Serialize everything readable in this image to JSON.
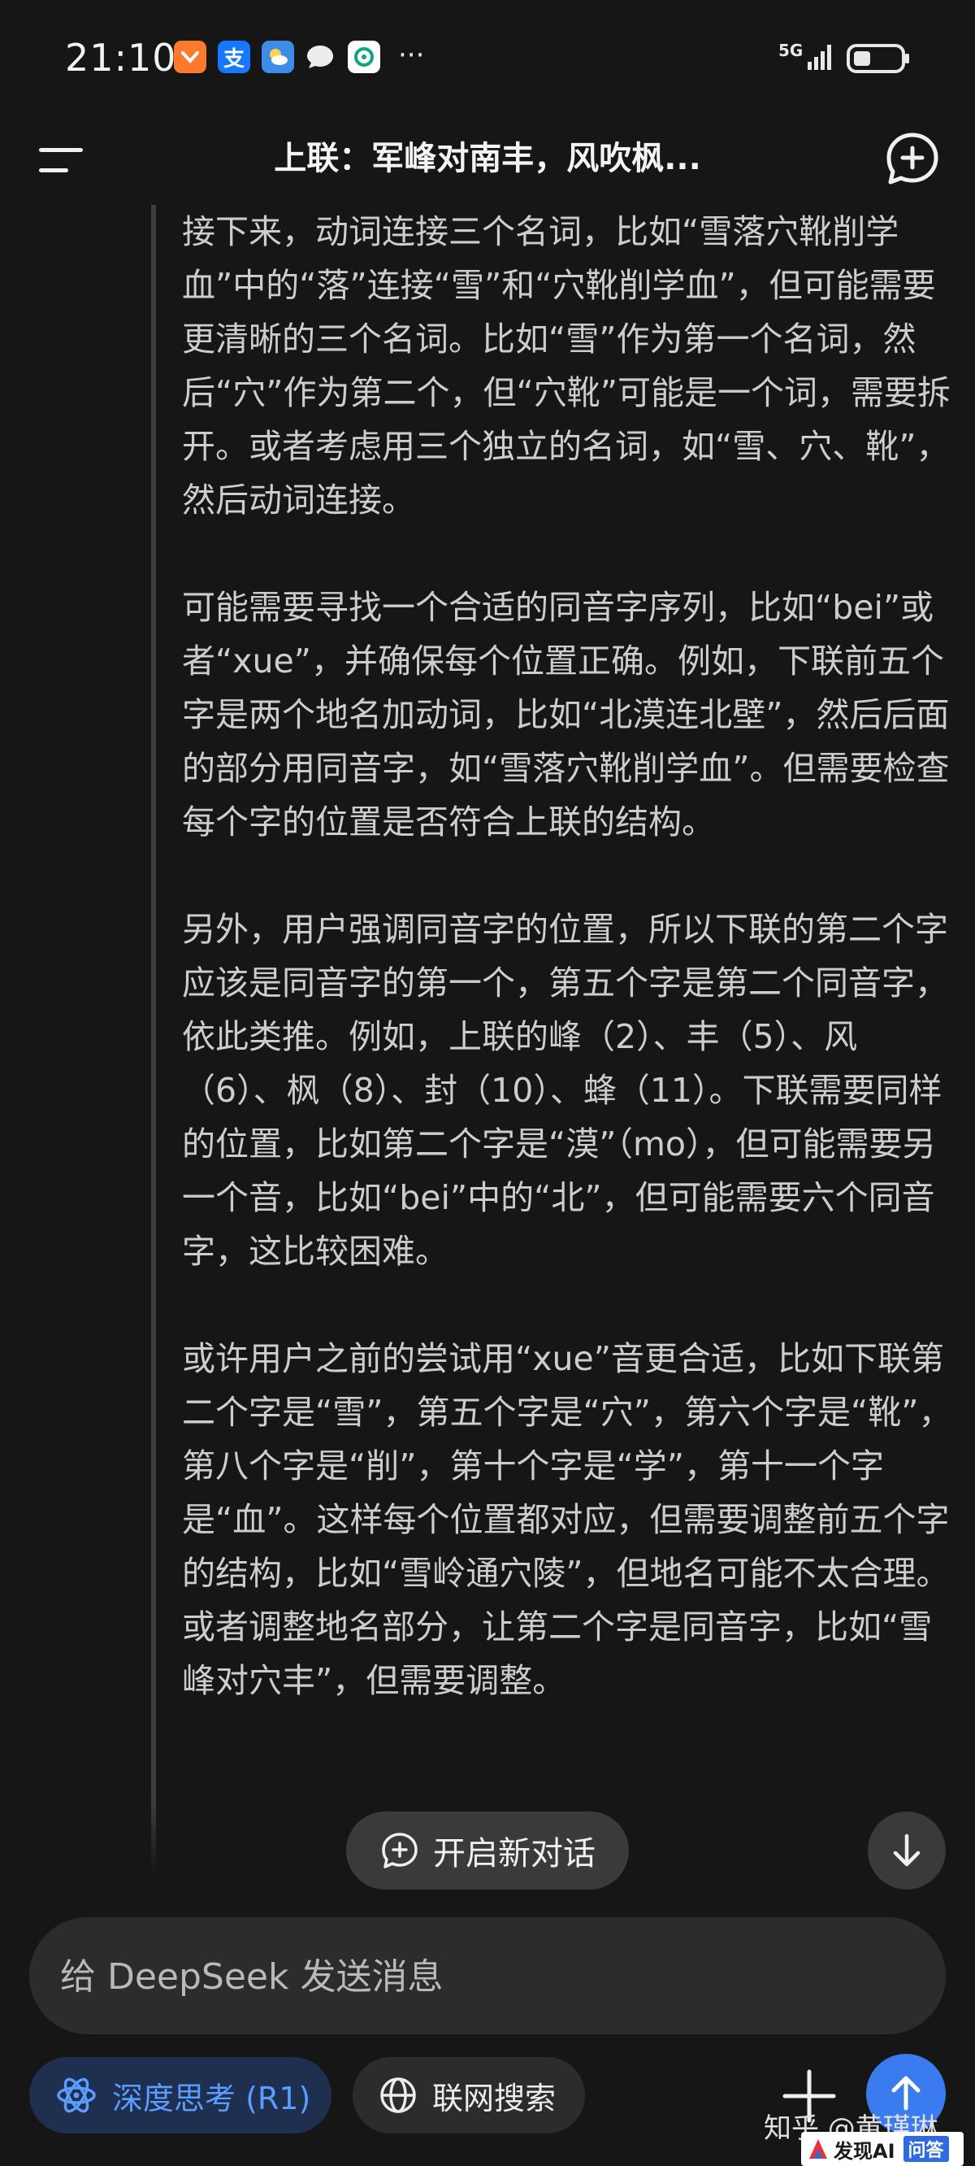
{
  "status_bar": {
    "time": "21:10",
    "network": "5G",
    "notification_icons": [
      "taobao-icon",
      "alipay-icon",
      "weather-icon",
      "message-icon",
      "chatgpt-icon"
    ],
    "more": "···"
  },
  "header": {
    "title": "上联：军峰对南丰，风吹枫..."
  },
  "thinking_paragraphs": [
    "接下来，动词连接三个名词，比如“雪落穴靴削学血”中的“落”连接“雪”和“穴靴削学血”，但可能需要更清晰的三个名词。比如“雪”作为第一个名词，然后“穴”作为第二个，但“穴靴”可能是一个词，需要拆开。或者考虑用三个独立的名词，如“雪、穴、靴”，然后动词连接。",
    "可能需要寻找一个合适的同音字序列，比如“bei”或者“xue”，并确保每个位置正确。例如，下联前五个字是两个地名加动词，比如“北漠连北壁”，然后后面的部分用同音字，如“雪落穴靴削学血”。但需要检查每个字的位置是否符合上联的结构。",
    "另外，用户强调同音字的位置，所以下联的第二个字应该是同音字的第一个，第五个字是第二个同音字，依此类推。例如，上联的峰（2）、丰（5）、风（6）、枫（8）、封（10）、蜂（11）。下联需要同样的位置，比如第二个字是“漠”（mo），但可能需要另一个音，比如“bei”中的“北”，但可能需要六个同音字，这比较困难。",
    "或许用户之前的尝试用“xue”音更合适，比如下联第二个字是“雪”，第五个字是“穴”，第六个字是“靴”，第八个字是“削”，第十个字是“学”，第十一个字是“血”。这样每个位置都对应，但需要调整前五个字的结构，比如“雪岭通穴陵”，但地名可能不太合理。或者调整地名部分，让第二个字是同音字，比如“雪峰对穴丰”，但需要调整。"
  ],
  "new_chat_label": "开启新对话",
  "composer": {
    "placeholder": "给 DeepSeek 发送消息"
  },
  "toolbar": {
    "deep_think_label": "深度思考 (R1)",
    "web_search_label": "联网搜索"
  },
  "watermark": {
    "zhihu": "知乎 @黄瑾琳",
    "fxai_text": "发现AI",
    "fxai_badge": "问答"
  },
  "colors": {
    "background": "#161616",
    "accent": "#3b7bf0",
    "deep_think_text": "#5a9cff"
  }
}
